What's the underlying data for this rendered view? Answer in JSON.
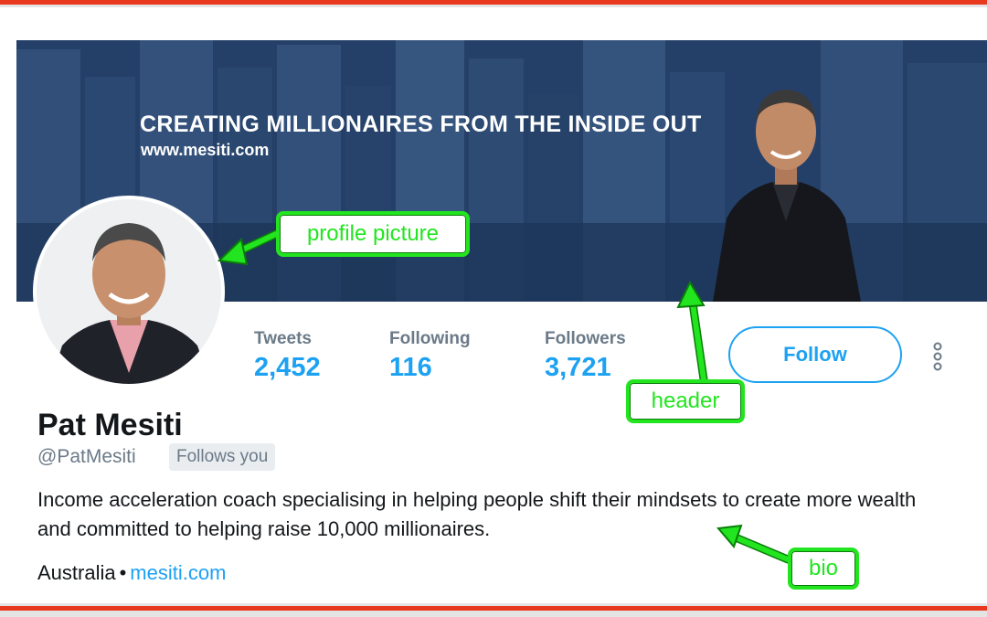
{
  "header": {
    "title": "CREATING MILLIONAIRES FROM THE INSIDE OUT",
    "url": "www.mesiti.com"
  },
  "stats": [
    {
      "label": "Tweets",
      "value": "2,452"
    },
    {
      "label": "Following",
      "value": "116"
    },
    {
      "label": "Followers",
      "value": "3,721"
    }
  ],
  "actions": {
    "follow_label": "Follow",
    "more_icon": "more-vertical-icon"
  },
  "profile": {
    "name": "Pat Mesiti",
    "handle": "@PatMesiti",
    "follows_you": "Follows you",
    "bio": "Income acceleration coach specialising in helping people shift their mindsets to create more wealth and committed to helping raise 10,000 millionaires.",
    "location": "Australia",
    "separator": "•",
    "website": "mesiti.com"
  },
  "annotations": {
    "profile_picture": "profile picture",
    "header": "header",
    "bio": "bio"
  },
  "colors": {
    "accent": "#1da1f2",
    "annotation": "#22e51f",
    "frame": "#e8391f"
  }
}
